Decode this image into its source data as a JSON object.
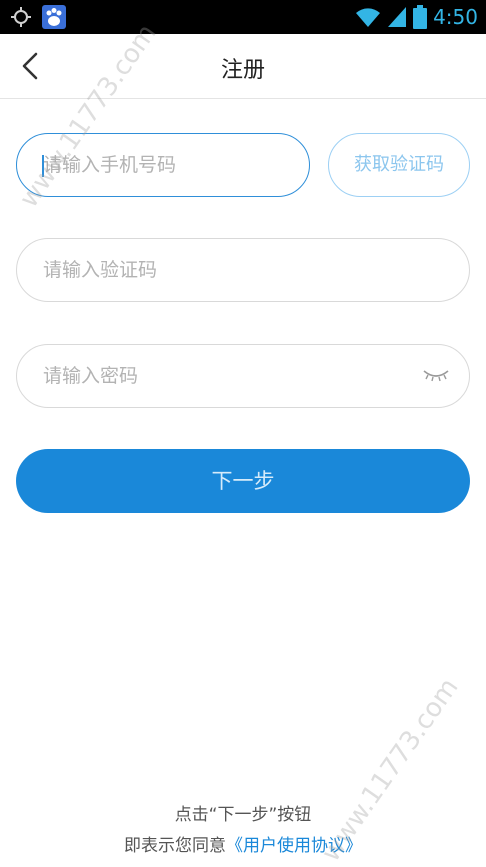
{
  "status_bar": {
    "time": "4:50",
    "icons": [
      "gps-icon",
      "baidu-app-icon",
      "wifi-icon",
      "signal-icon",
      "battery-icon"
    ],
    "color": "#33b5e5"
  },
  "header": {
    "title": "注册",
    "back_icon": "chevron-left-icon"
  },
  "form": {
    "phone_placeholder": "请输入手机号码",
    "get_code_label": "获取验证码",
    "code_placeholder": "请输入验证码",
    "password_placeholder": "请输入密码",
    "password_toggle_icon": "eye-closed-icon",
    "next_label": "下一步"
  },
  "agreement": {
    "line1": "点击“下一步”按钮",
    "line2_prefix": "即表示您同意",
    "link": "《用户使用协议》"
  },
  "watermark": "www.11773.com",
  "colors": {
    "accent": "#1a88d9",
    "active_border": "#2f8fd9",
    "placeholder": "#b3b3b3"
  }
}
